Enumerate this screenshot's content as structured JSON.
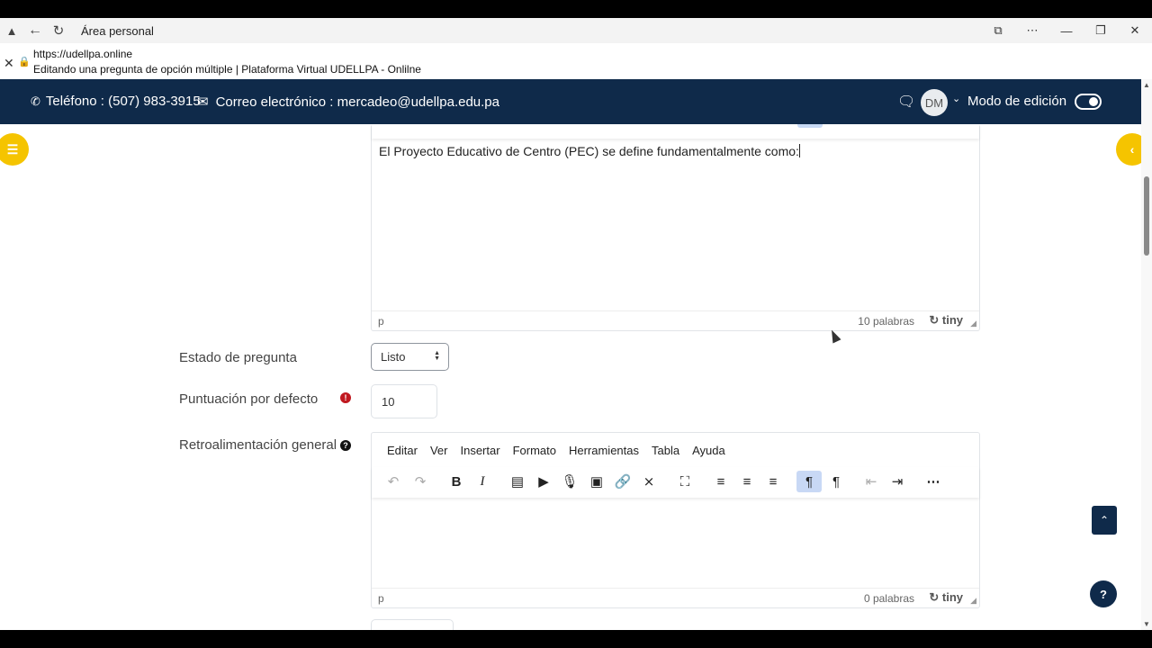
{
  "browser": {
    "window_title": "Área personal",
    "url": "https://udellpa.online",
    "page_title": "Editando una pregunta de opción múltiple | Plataforma Virtual UDELLPA - Onlilne"
  },
  "header": {
    "phone": "Teléfono : (507) 983-3915",
    "email": "Correo electrónico : mercadeo@udellpa.edu.pa",
    "avatar_initials": "DM",
    "edit_mode_label": "Modo de edición",
    "edit_mode_on": true
  },
  "question_editor": {
    "text": "El Proyecto Educativo de Centro (PEC) se define fundamentalmente como:",
    "path": "p",
    "word_count": "10 palabras",
    "brand": "tiny"
  },
  "form": {
    "estado_label": "Estado de pregunta",
    "estado_value": "Listo",
    "puntuacion_label": "Puntuación por defecto",
    "puntuacion_value": "10",
    "retro_label": "Retroalimentación general"
  },
  "feedback_editor": {
    "menu": [
      "Editar",
      "Ver",
      "Insertar",
      "Formato",
      "Herramientas",
      "Tabla",
      "Ayuda"
    ],
    "path": "p",
    "word_count": "0 palabras",
    "brand": "tiny"
  },
  "help_fab_label": "?"
}
